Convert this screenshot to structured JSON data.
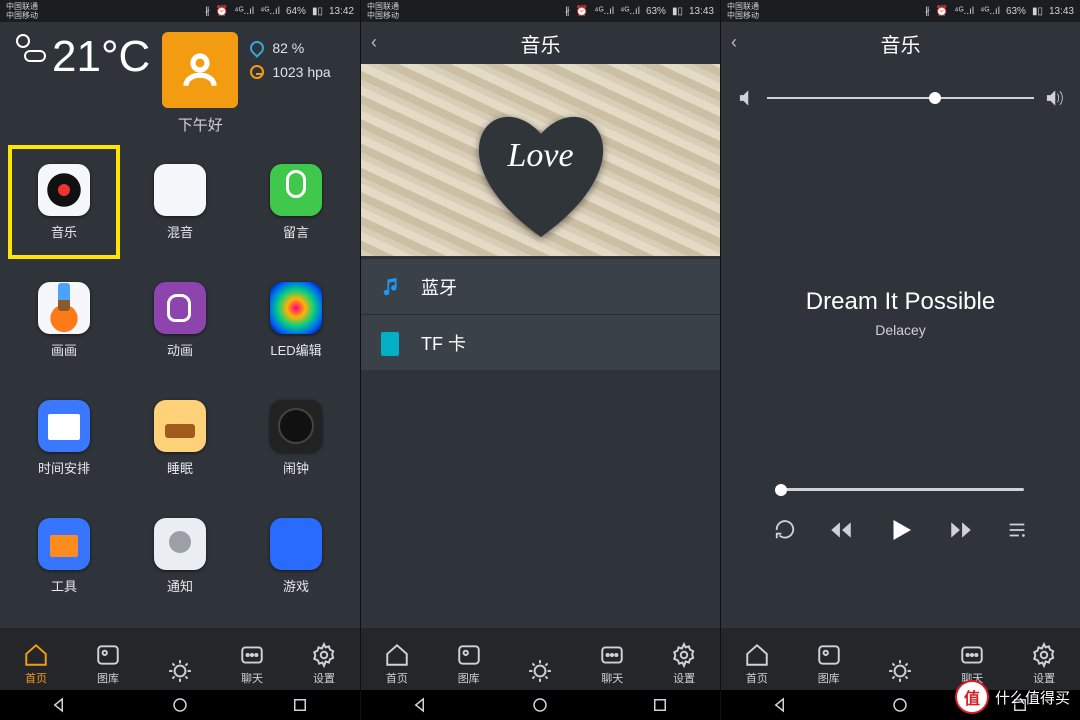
{
  "status": [
    {
      "carrier1": "中国联通",
      "carrier2": "中国移动",
      "battery": "64%",
      "time": "13:42"
    },
    {
      "carrier1": "中国联通",
      "carrier2": "中国移动",
      "battery": "63%",
      "time": "13:43"
    },
    {
      "carrier1": "中国联通",
      "carrier2": "中国移动",
      "battery": "63%",
      "time": "13:43"
    }
  ],
  "weather": {
    "temp": "21°C",
    "greeting": "下午好",
    "humidity": "82 %",
    "pressure": "1023 hpa"
  },
  "apps": [
    {
      "label": "音乐",
      "selected": true,
      "tile": "t-music"
    },
    {
      "label": "混音",
      "tile": "t-mix"
    },
    {
      "label": "留言",
      "tile": "t-mic"
    },
    {
      "label": "画画",
      "tile": "t-paint"
    },
    {
      "label": "动画",
      "tile": "t-anim"
    },
    {
      "label": "LED编辑",
      "tile": "t-led"
    },
    {
      "label": "时间安排",
      "tile": "t-time"
    },
    {
      "label": "睡眠",
      "tile": "t-sleep"
    },
    {
      "label": "闹钟",
      "tile": "t-clock"
    },
    {
      "label": "工具",
      "tile": "t-tools"
    },
    {
      "label": "通知",
      "tile": "t-notify"
    },
    {
      "label": "游戏",
      "tile": "t-games"
    }
  ],
  "tabs": [
    {
      "label": "首页",
      "icon": "home"
    },
    {
      "label": "图库",
      "icon": "gallery"
    },
    {
      "label": "",
      "icon": "brightness"
    },
    {
      "label": "聊天",
      "icon": "chat"
    },
    {
      "label": "设置",
      "icon": "settings"
    }
  ],
  "pane2": {
    "title": "音乐",
    "heart": "Love",
    "sources": [
      {
        "label": "蓝牙",
        "icon": "note"
      },
      {
        "label": "TF 卡",
        "icon": "card"
      }
    ]
  },
  "pane3": {
    "title": "音乐",
    "song": "Dream It Possible",
    "artist": "Delacey",
    "volume": 0.63,
    "progress": 0.02
  },
  "watermark": "什么值得买"
}
